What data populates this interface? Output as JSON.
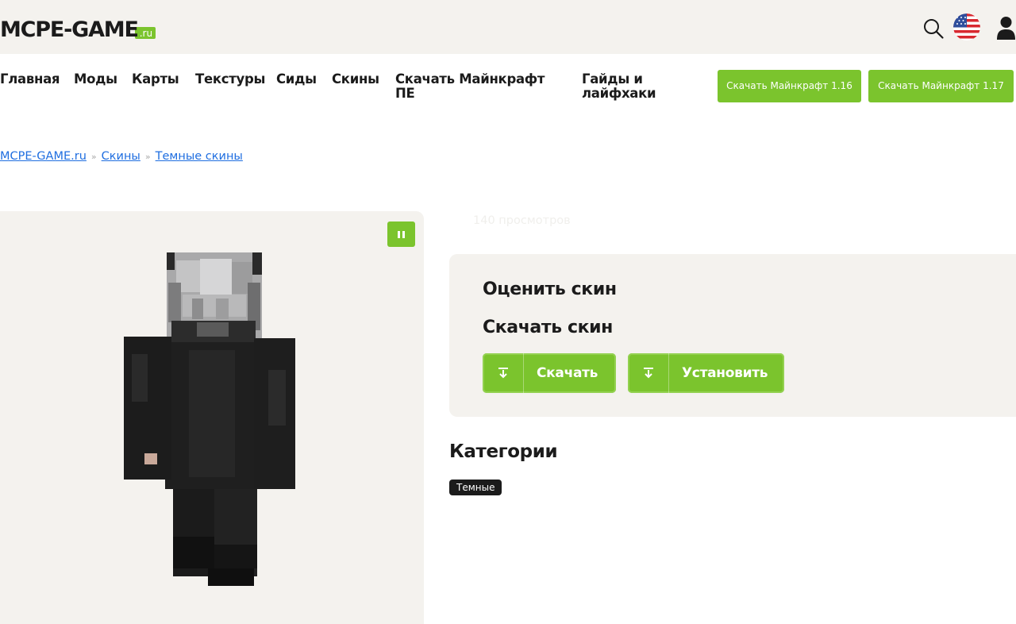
{
  "header": {
    "logo_main": "MCPE-GAME",
    "logo_suffix": ".ru",
    "icons": [
      "search-icon",
      "us-flag-icon",
      "user-icon"
    ]
  },
  "nav": {
    "items": [
      "Главная",
      "Моды",
      "Карты",
      "Текстуры",
      "Сиды",
      "Скины",
      "Скачать Майнкрафт ПЕ",
      "Гайды и лайфхаки"
    ],
    "buttons": [
      "Скачать Майнкрафт 1.16",
      "Скачать Майнкрафт 1.17"
    ]
  },
  "breadcrumb": {
    "items": [
      "MCPE-GAME.ru",
      "Скины",
      "Темные скины"
    ],
    "separator": "»"
  },
  "skin_viewer": {
    "pause_icon": "pause-icon"
  },
  "views_text": "140 просмотров",
  "rating": {
    "title": "Оценить скин",
    "download_title": "Скачать скин",
    "download_button": "Скачать",
    "install_button": "Установить",
    "button_icon": "download-icon"
  },
  "categories": {
    "title": "Категории",
    "tags": [
      "Темные"
    ]
  },
  "colors": {
    "accent": "#7bc42d",
    "panel_bg": "#f4f2ee",
    "text": "#1b1b1b",
    "link": "#1f6ee0"
  }
}
